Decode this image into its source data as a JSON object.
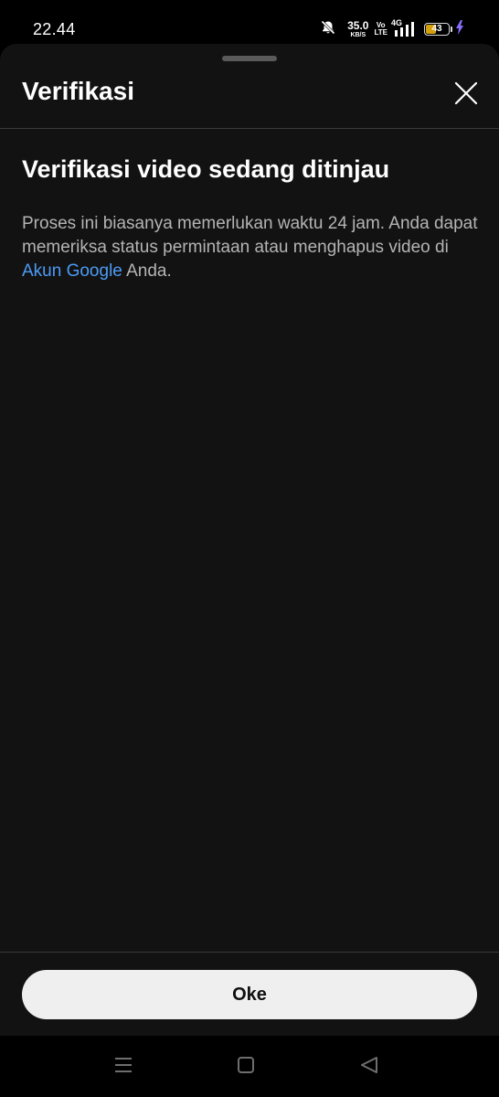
{
  "status_bar": {
    "time": "22.44",
    "net_speed_value": "35.0",
    "net_speed_unit": "KB/S",
    "volte_top": "Vo",
    "volte_bottom": "LTE",
    "network_type": "4G",
    "battery_level": "43",
    "icons": [
      "mute-bell-icon",
      "signal-icon",
      "battery-icon",
      "charging-bolt-icon"
    ]
  },
  "sheet": {
    "title": "Verifikasi",
    "heading": "Verifikasi video sedang ditinjau",
    "body_before_link": "Proses ini biasanya memerlukan waktu 24 jam. Anda dapat memeriksa status permintaan atau menghapus video di ",
    "link_text": "Akun Google",
    "body_after_link": " Anda.",
    "ok_button": "Oke"
  },
  "nav_bar": {
    "icons": [
      "menu-icon",
      "home-icon",
      "back-icon"
    ]
  },
  "colors": {
    "sheet_background": "#121212",
    "link": "#4c9bf5",
    "button_background": "#efefef",
    "battery_fill": "#d4a10c",
    "charging_bolt": "#8a6cff"
  }
}
